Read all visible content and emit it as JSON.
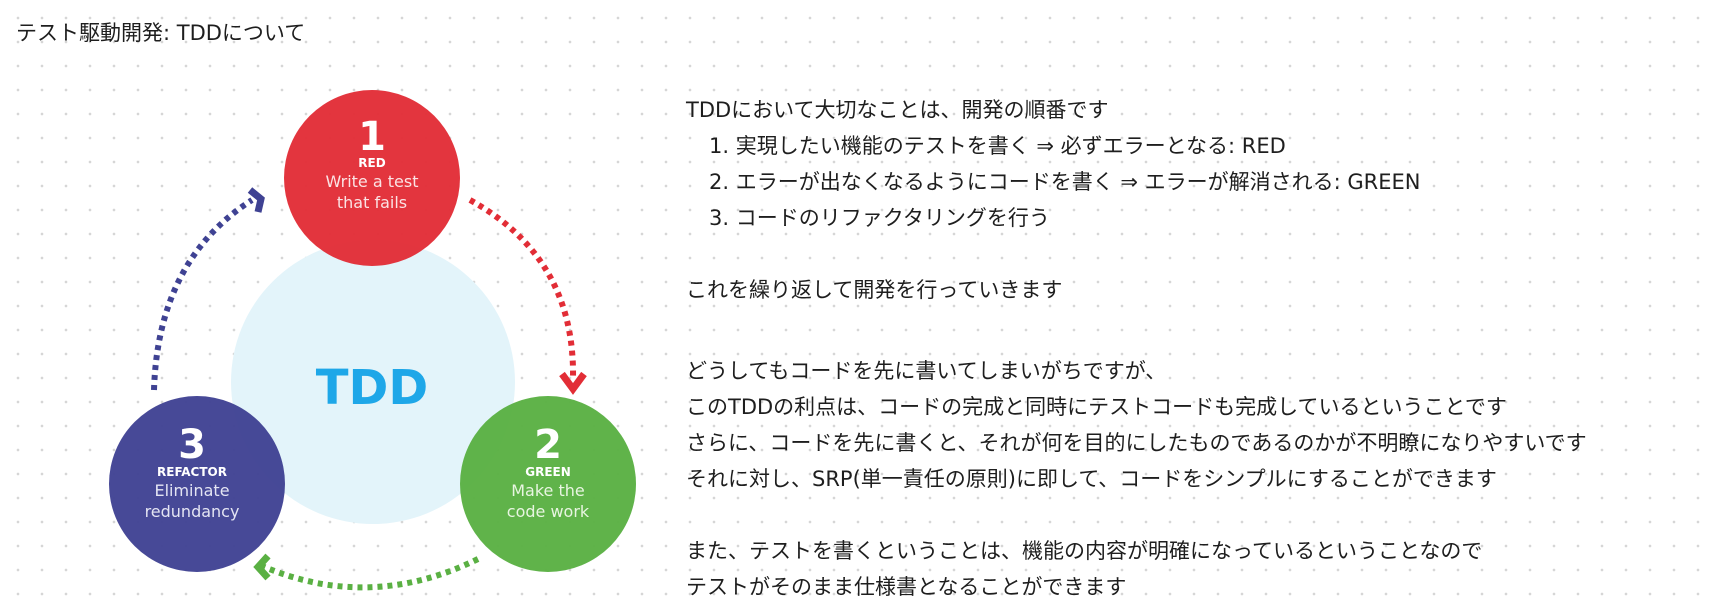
{
  "board": {
    "title": "テスト駆動開発: TDDについて"
  },
  "diagram": {
    "center_label": "TDD",
    "colors": {
      "center": "#e3f4fa",
      "center_text": "#1ea7e8",
      "red": "#e22d36",
      "green": "#5ab043",
      "blue": "#3f4293"
    },
    "stages": [
      {
        "number": "1",
        "name": "RED",
        "desc_line1": "Write a test",
        "desc_line2": "that fails"
      },
      {
        "number": "2",
        "name": "GREEN",
        "desc_line1": "Make the",
        "desc_line2": "code work"
      },
      {
        "number": "3",
        "name": "REFACTOR",
        "desc_line1": "Eliminate",
        "desc_line2": "redundancy"
      }
    ]
  },
  "notes": {
    "intro": "TDDにおいて大切なことは、開発の順番です",
    "steps": [
      "1. 実現したい機能のテストを書く ⇒ 必ずエラーとなる: RED",
      "2. エラーが出なくなるようにコードを書く ⇒ エラーが解消される: GREEN",
      "3. コードのリファクタリングを行う"
    ],
    "repeat": "これを繰り返して開発を行っていきます",
    "benefits": [
      "どうしてもコードを先に書いてしまいがちですが、",
      "このTDDの利点は、コードの完成と同時にテストコードも完成しているということです",
      "さらに、コードを先に書くと、それが何を目的にしたものであるのかが不明瞭になりやすいです",
      "それに対し、SRP(単一責任の原則)に即して、コードをシンプルにすることができます"
    ],
    "spec": [
      "また、テストを書くということは、機能の内容が明確になっているということなので",
      "テストがそのまま仕様書となることができます"
    ]
  }
}
